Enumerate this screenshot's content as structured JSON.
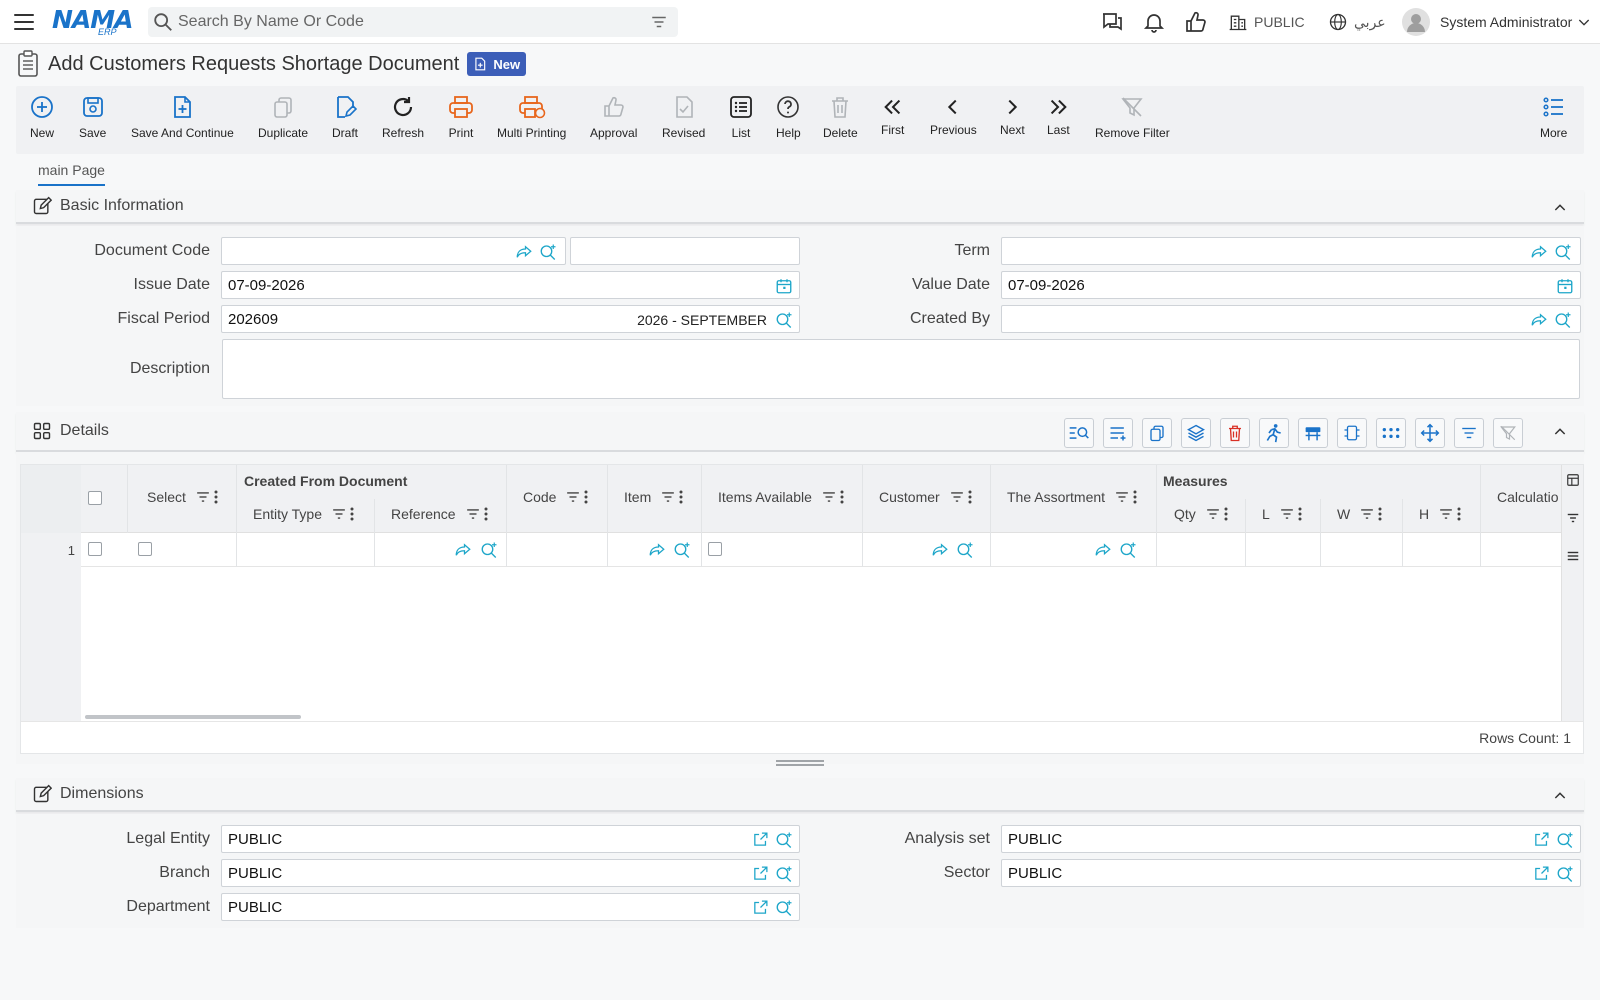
{
  "app": {
    "logo_main": "NAMA",
    "logo_sub": "ERP",
    "search_placeholder": "Search By Name Or Code",
    "company": "PUBLIC",
    "language": "عربي",
    "user": "System Administrator"
  },
  "page": {
    "title": "Add Customers Requests Shortage Document",
    "badge": "New"
  },
  "toolbar": {
    "new": "New",
    "save": "Save",
    "save_continue": "Save And Continue",
    "duplicate": "Duplicate",
    "draft": "Draft",
    "refresh": "Refresh",
    "print": "Print",
    "multi_printing": "Multi Printing",
    "approval": "Approval",
    "revised": "Revised",
    "list": "List",
    "help": "Help",
    "delete": "Delete",
    "first": "First",
    "previous": "Previous",
    "next": "Next",
    "last": "Last",
    "remove_filter": "Remove Filter",
    "more": "More"
  },
  "tabs": {
    "main": "main Page"
  },
  "basic": {
    "title": "Basic Information",
    "document_code_label": "Document Code",
    "document_code": "",
    "term_label": "Term",
    "term": "",
    "issue_date_label": "Issue Date",
    "issue_date": "07-09-2026",
    "value_date_label": "Value Date",
    "value_date": "07-09-2026",
    "fiscal_period_label": "Fiscal Period",
    "fiscal_period": "202609",
    "fiscal_period_name": "2026 - SEPTEMBER",
    "created_by_label": "Created By",
    "created_by": "",
    "description_label": "Description",
    "description": ""
  },
  "details": {
    "title": "Details",
    "headers": {
      "select": "Select",
      "created_from": "Created From Document",
      "entity_type": "Entity Type",
      "reference": "Reference",
      "code": "Code",
      "item": "Item",
      "items_available": "Items Available",
      "customer": "Customer",
      "assortment": "The Assortment",
      "measures": "Measures",
      "qty": "Qty",
      "l": "L",
      "w": "W",
      "h": "H",
      "calculation": "Calculatio"
    },
    "rows": [
      {
        "num": "1"
      }
    ],
    "rows_count": "Rows Count: 1"
  },
  "dimensions": {
    "title": "Dimensions",
    "legal_entity_label": "Legal Entity",
    "legal_entity": "PUBLIC",
    "analysis_set_label": "Analysis set",
    "analysis_set": "PUBLIC",
    "branch_label": "Branch",
    "branch": "PUBLIC",
    "sector_label": "Sector",
    "sector": "PUBLIC",
    "department_label": "Department",
    "department": "PUBLIC"
  },
  "colors": {
    "accent": "#1a73c9",
    "orange": "#e8661c",
    "teal": "#1da6c9",
    "red": "#d93025",
    "badge": "#3c5eb8"
  }
}
